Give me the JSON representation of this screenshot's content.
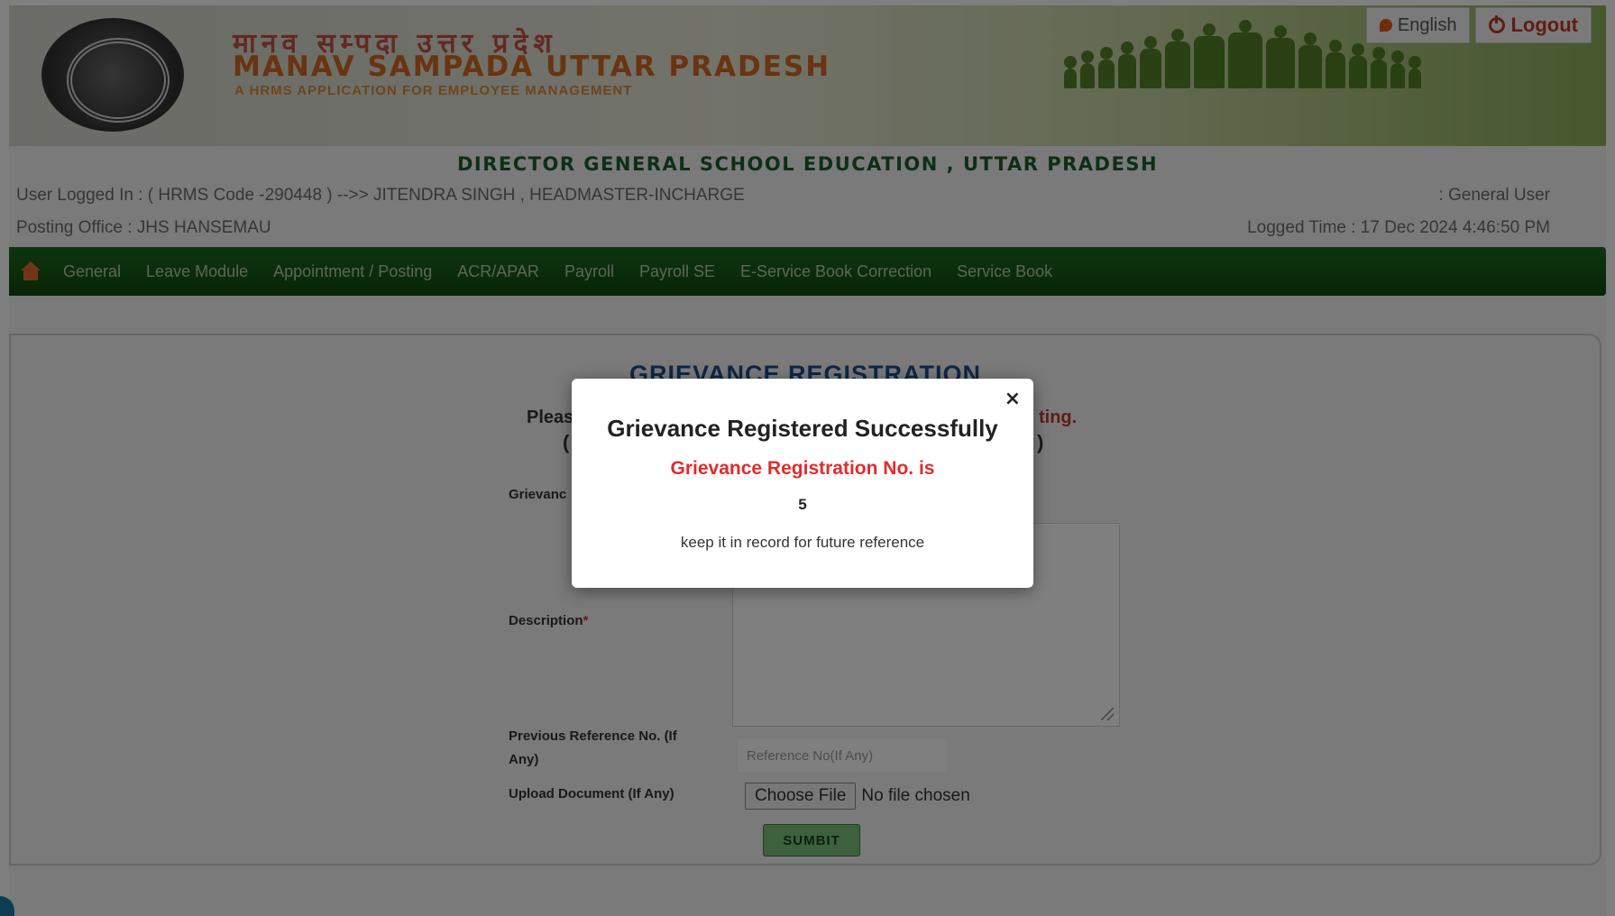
{
  "header": {
    "title_hindi": "मानव सम्पदा उत्तर प्रदेश",
    "title_english": "MANAV SAMPADA UTTAR PRADESH",
    "subtitle": "A HRMS APPLICATION FOR EMPLOYEE MANAGEMENT",
    "language_button": "English",
    "logout_button": "Logout"
  },
  "department": "DIRECTOR GENERAL SCHOOL EDUCATION , UTTAR PRADESH",
  "user_info": {
    "logged_in": "User Logged In : ( HRMS Code -290448 ) -->> JITENDRA SINGH , HEADMASTER-INCHARGE",
    "role": ": General User",
    "posting_office": "Posting Office : JHS HANSEMAU",
    "logged_time": "Logged Time : 17 Dec 2024 4:46:50 PM"
  },
  "nav": {
    "items": [
      "General",
      "Leave Module",
      "Appointment / Posting",
      "ACR/APAR",
      "Payroll",
      "Payroll SE",
      "E-Service Book Correction",
      "Service Book"
    ]
  },
  "form": {
    "title": "GRIEVANCE REGISTRATION",
    "notice_line1_left": "Pleas",
    "notice_line1_right": "ting.",
    "notice_line2_left": "(",
    "notice_line2_right": ")",
    "grievance_label": "Grievanc",
    "description_label": "Description",
    "prev_ref_label": "Previous Reference No. (If Any)",
    "prev_ref_placeholder": "Reference No(If Any)",
    "upload_label": "Upload Document (If Any)",
    "choose_file_button": "Choose File",
    "file_status": "No file chosen",
    "submit_button": "SUMBIT"
  },
  "modal": {
    "close": "×",
    "title": "Grievance Registered Successfully",
    "reg_label": "Grievance Registration No. is",
    "reg_number": "5",
    "note": "keep it in record for future reference"
  },
  "colors": {
    "nav_green": "#0e4a0f",
    "dept_title": "#1d5e2b",
    "form_title": "#1d4e8f",
    "reg_label_red": "#e32b2b",
    "submit_green": "#7bc07b"
  }
}
